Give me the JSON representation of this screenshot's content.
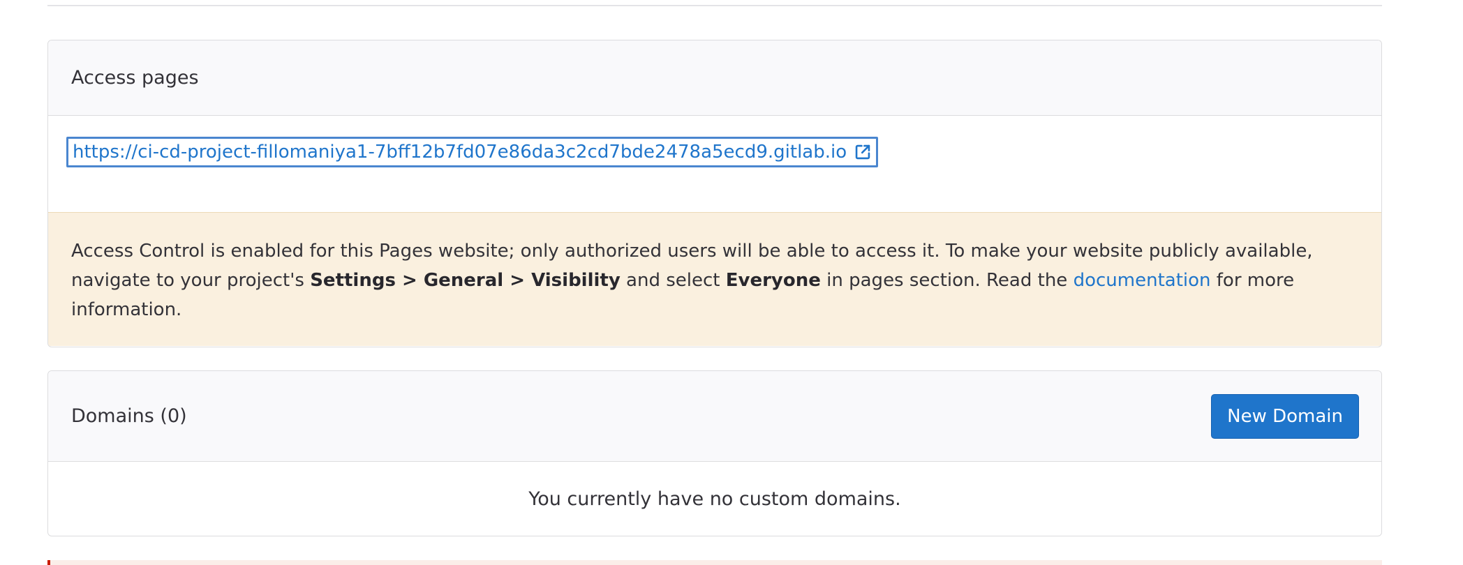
{
  "access_pages": {
    "title": "Access pages",
    "url": "https://ci-cd-project-fillomaniya1-7bff12b7fd07e86da3c2cd7bde2478a5ecd9.gitlab.io",
    "external_icon": "external-link-icon",
    "alert": {
      "text_1": "Access Control is enabled for this Pages website; only authorized users will be able to access it. To make your website publicly available, navigate to your project's ",
      "bold_path": "Settings > General > Visibility",
      "text_2": " and select ",
      "bold_everyone": "Everyone",
      "text_3": " in pages section. Read the ",
      "link_label": "documentation",
      "text_4": " for more information."
    }
  },
  "domains": {
    "title": "Domains (0)",
    "new_button_label": "New Domain",
    "empty_message": "You currently have no custom domains."
  },
  "colors": {
    "link": "#1f75cb",
    "alert_bg": "#faf0df",
    "header_bg": "#f9f9fb",
    "button_bg": "#1f75cb",
    "danger_border": "#c91c00"
  }
}
